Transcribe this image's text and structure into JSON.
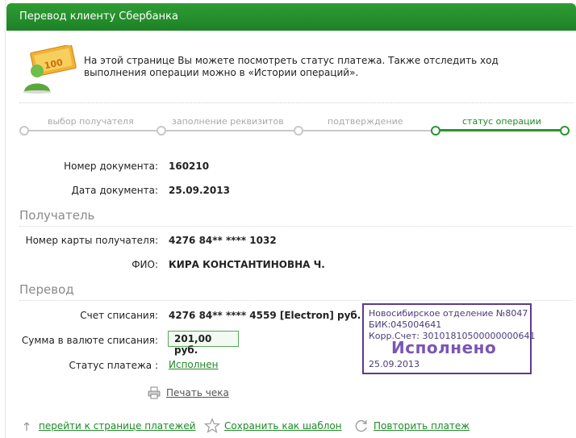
{
  "header": {
    "title": "Перевод клиенту Сбербанка"
  },
  "intro": {
    "icon": "money-transfer-icon",
    "text": "На этой странице Вы можете посмотреть статус платежа. Также отследить ход выполнения операции можно в «Истории операций»."
  },
  "steps": [
    {
      "label": "выбор получателя",
      "state": "done"
    },
    {
      "label": "заполнение реквизитов",
      "state": "done"
    },
    {
      "label": "подтверждение",
      "state": "done"
    },
    {
      "label": "статус операции",
      "state": "active"
    }
  ],
  "document": {
    "number_label": "Номер документа:",
    "number": "160210",
    "date_label": "Дата документа:",
    "date": "25.09.2013"
  },
  "recipient": {
    "section_title": "Получатель",
    "card_label": "Номер карты получателя:",
    "card": "4276 84** **** 1032",
    "name_label": "ФИО:",
    "name": "КИРА КОНСТАНТИНОВНА Ч."
  },
  "transfer": {
    "section_title": "Перевод",
    "account_label": "Счет списания:",
    "account": "4276 84** **** 4559  [Electron]  руб.",
    "amount_label": "Сумма в валюте списания:",
    "amount": "201,00  руб.",
    "status_label": "Статус платежа :",
    "status": "Исполнен"
  },
  "stamp": {
    "line1": "Новосибирское отделение №8047",
    "line2": "БИК:045004641",
    "line3": "Корр.Счет: 30101810500000000641",
    "status": "Исполнено",
    "date": "25.09.2013"
  },
  "actions": {
    "print": "Печать чека",
    "back": "перейти к странице платежей",
    "save_template": "Сохранить как шаблон",
    "repeat": "Повторить платеж"
  },
  "colors": {
    "brand_green": "#1e8a27",
    "stamp_purple": "#5d3a8c"
  }
}
